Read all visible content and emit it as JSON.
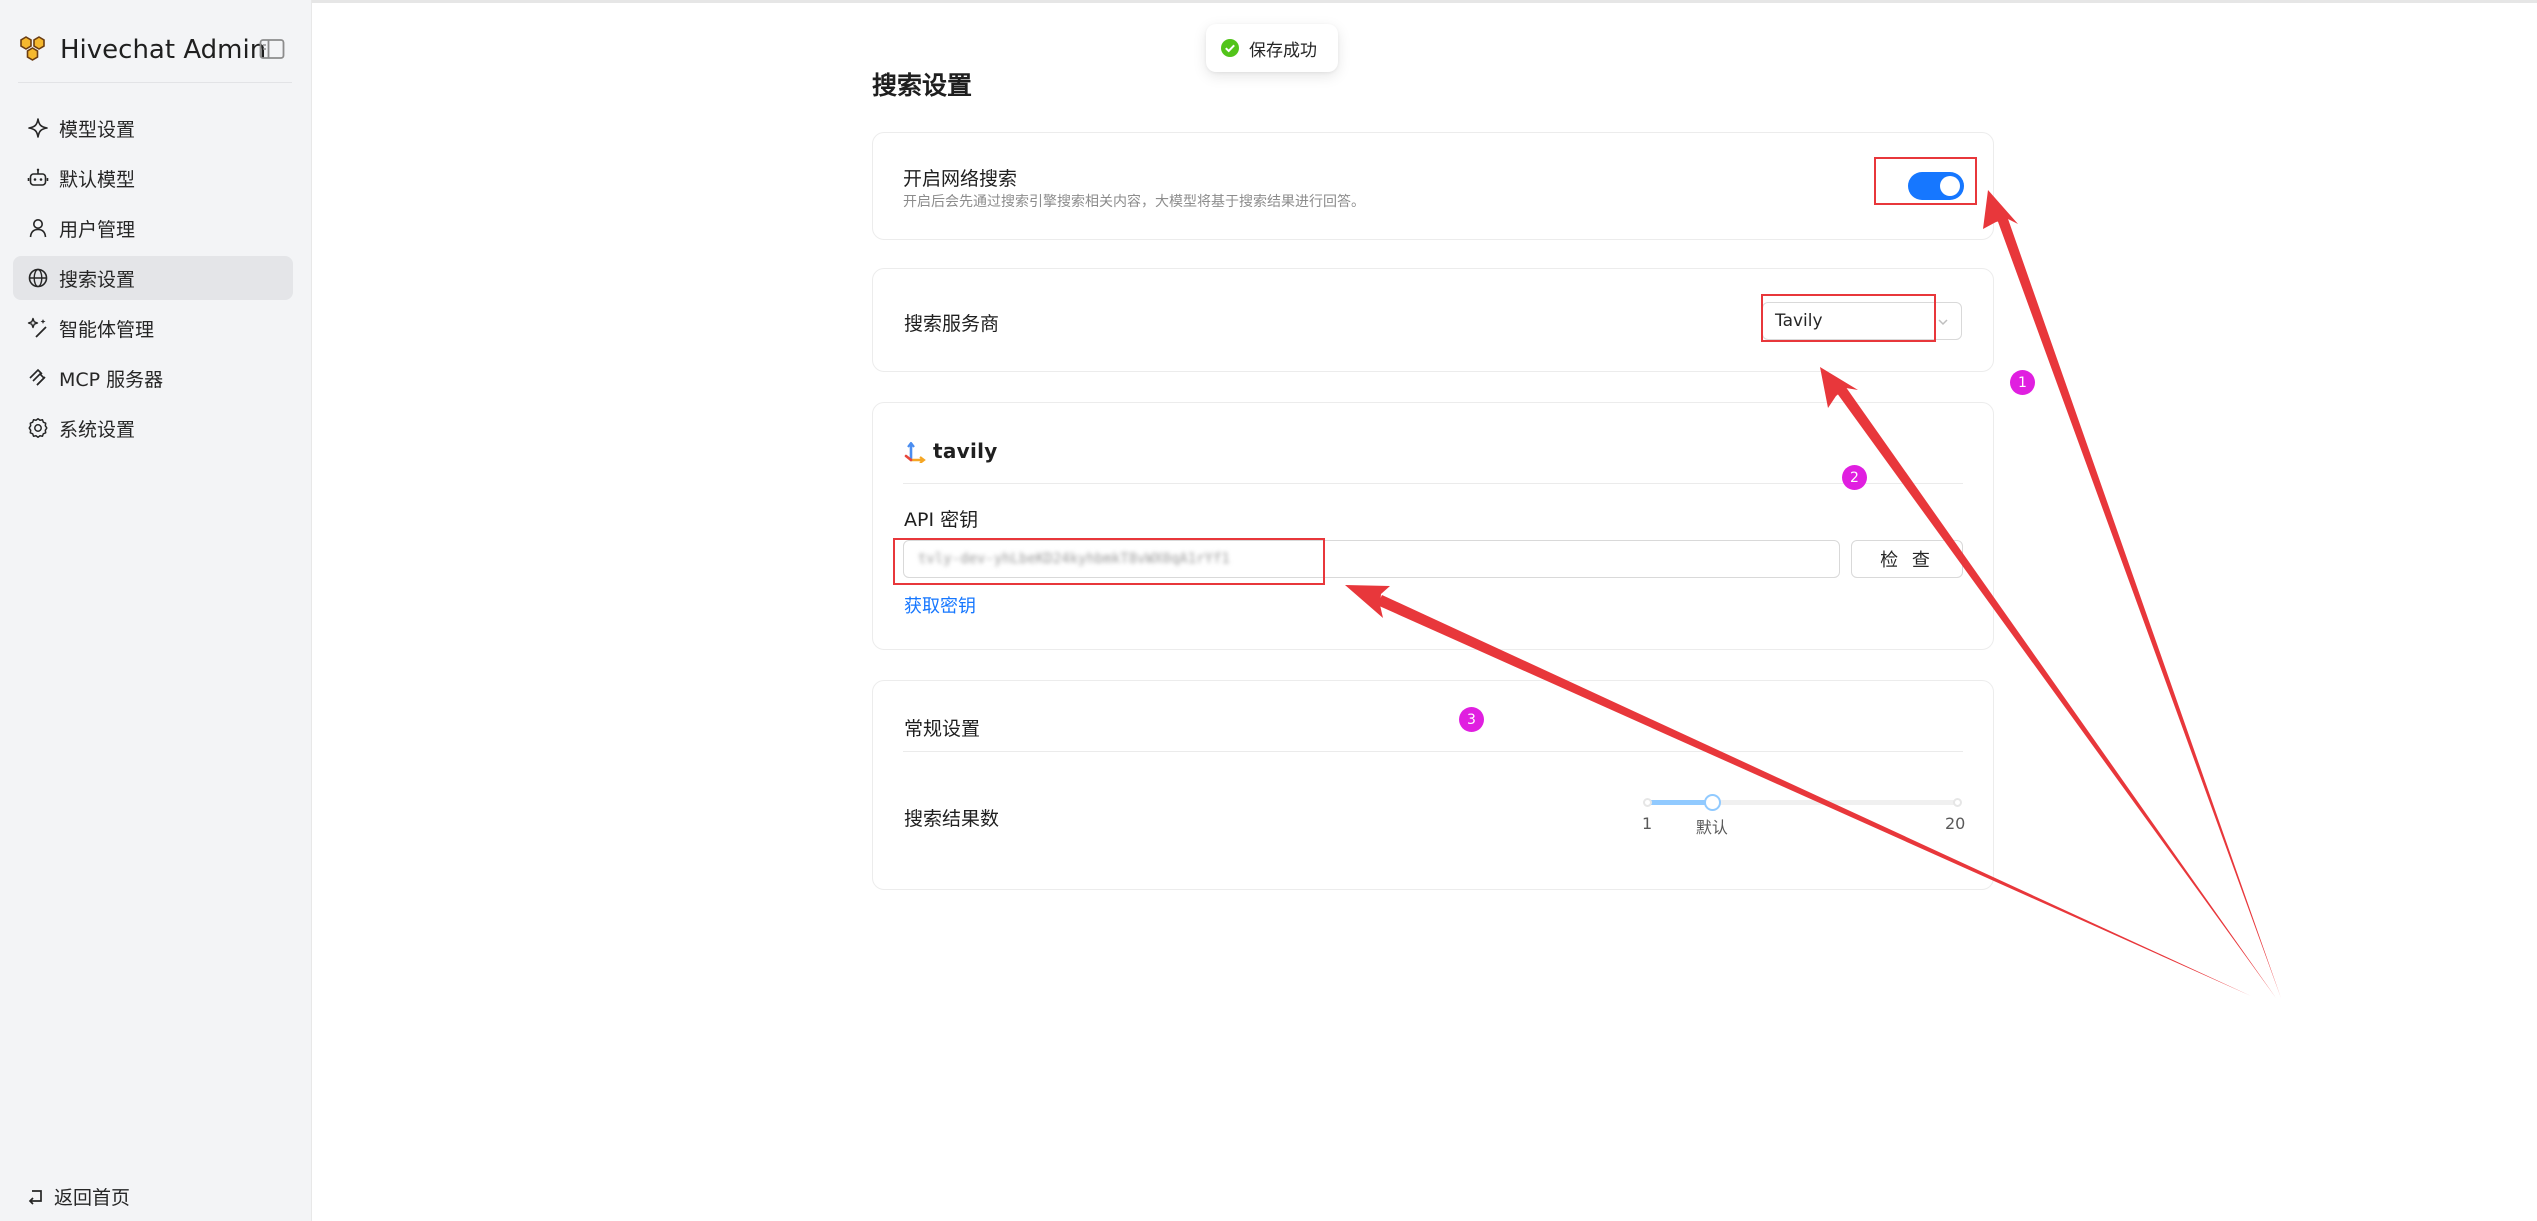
{
  "app": {
    "title": "Hivechat Admin"
  },
  "sidebar": {
    "items": [
      {
        "label": "模型设置",
        "icon": "sparkle-icon"
      },
      {
        "label": "默认模型",
        "icon": "robot-icon"
      },
      {
        "label": "用户管理",
        "icon": "user-icon"
      },
      {
        "label": "搜索设置",
        "icon": "globe-icon",
        "active": true
      },
      {
        "label": "智能体管理",
        "icon": "magic-icon"
      },
      {
        "label": "MCP 服务器",
        "icon": "mcp-icon"
      },
      {
        "label": "系统设置",
        "icon": "gear-icon"
      }
    ],
    "back_home": "返回首页"
  },
  "toast": {
    "message": "保存成功"
  },
  "page": {
    "title": "搜索设置"
  },
  "web_search": {
    "title": "开启网络搜索",
    "description": "开启后会先通过搜索引擎搜索相关内容，大模型将基于搜索结果进行回答。",
    "enabled": true
  },
  "provider": {
    "label": "搜索服务商",
    "value": "Tavily"
  },
  "tavily": {
    "logo_text": "tavily",
    "api_key_label": "API 密钥",
    "api_key_value": "tvly-dev-yhLbeKD24kyhbmkT8vWX0qA1rYf1",
    "check_label": "检 查",
    "get_key_label": "获取密钥"
  },
  "general": {
    "title": "常规设置",
    "results_label": "搜索结果数",
    "slider": {
      "min": 1,
      "max": 20,
      "value": 5,
      "min_label": "1",
      "default_label": "默认",
      "max_label": "20"
    }
  },
  "annotations": {
    "badges": [
      "1",
      "2",
      "3"
    ]
  },
  "colors": {
    "accent": "#1677ff",
    "annotation_red": "#e8373b",
    "badge_magenta": "#e01fe0",
    "success": "#52c41a"
  }
}
